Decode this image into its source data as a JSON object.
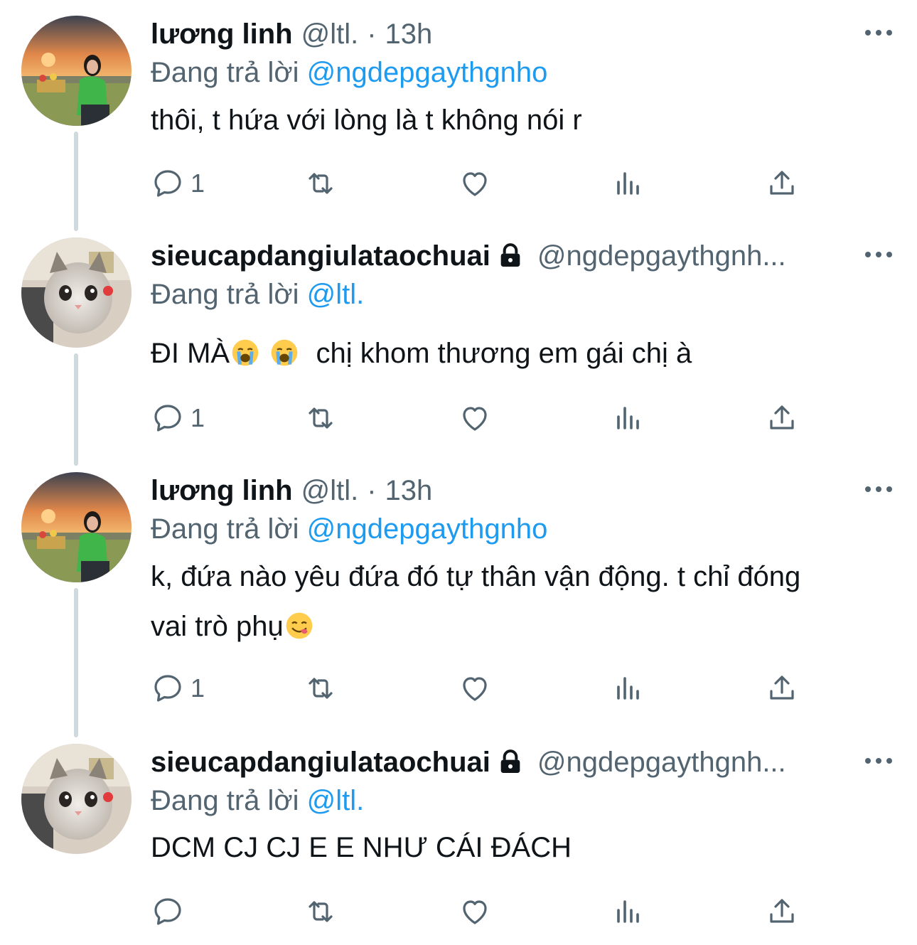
{
  "colors": {
    "text_primary": "#0f1419",
    "text_secondary": "#536471",
    "link": "#1d9bf0",
    "thread_line": "#cfd9de"
  },
  "tweets": [
    {
      "display_name": "lương linh",
      "handle": "@ltl.",
      "separator": "·",
      "time": "13h",
      "protected": false,
      "reply_prefix": "Đang trả lời",
      "reply_to": "@ngdepgaythgnho",
      "text_lines": [
        "thôi, t hứa với lòng là t không nói r"
      ],
      "reply_count": "1",
      "avatar": "sunset-avatar"
    },
    {
      "display_name": "sieucapdangiulataochuai",
      "handle": "@ngdepgaythgnh...",
      "protected": true,
      "reply_prefix": "Đang trả lời",
      "reply_to": "@ltl.",
      "text_parts": [
        "ĐI MÀ",
        "  chị khom thương em gái chị à"
      ],
      "reply_count": "1",
      "avatar": "cat-avatar"
    },
    {
      "display_name": "lương linh",
      "handle": "@ltl.",
      "separator": "·",
      "time": "13h",
      "protected": false,
      "reply_prefix": "Đang trả lời",
      "reply_to": "@ngdepgaythgnho",
      "text_lines": [
        "k, đứa nào yêu đứa đó tự thân vận động. t chỉ đóng",
        "vai trò phụ"
      ],
      "reply_count": "1",
      "avatar": "sunset-avatar"
    },
    {
      "display_name": "sieucapdangiulataochuai",
      "handle": "@ngdepgaythgnh...",
      "protected": true,
      "reply_prefix": "Đang trả lời",
      "reply_to": "@ltl.",
      "text_lines": [
        "DCM CJ CJ E E NHƯ CÁI ĐÁCH"
      ],
      "reply_count": "",
      "avatar": "cat-avatar"
    }
  ]
}
